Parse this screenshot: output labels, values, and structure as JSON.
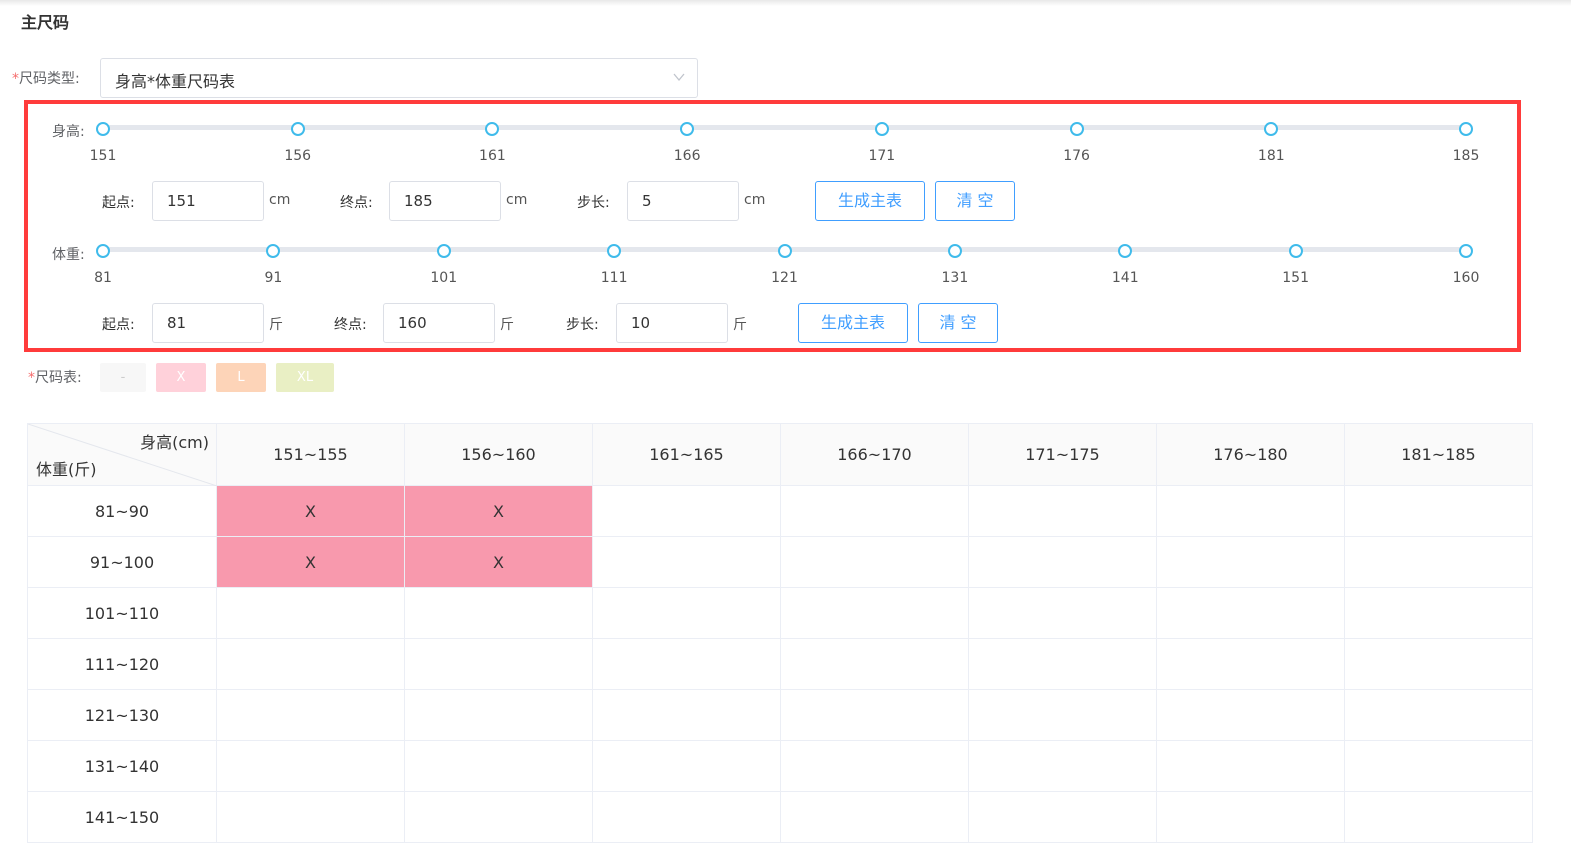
{
  "section_title": "主尺码",
  "size_type": {
    "required_mark": "*",
    "label": "尺码类型:",
    "value": "身高*体重尺码表"
  },
  "height": {
    "label": "身高:",
    "ticks": [
      "151",
      "156",
      "161",
      "166",
      "171",
      "176",
      "181",
      "185"
    ],
    "start_label": "起点:",
    "start_value": "151",
    "end_label": "终点:",
    "end_value": "185",
    "step_label": "步长:",
    "step_value": "5",
    "unit": "cm",
    "generate_button": "生成主表",
    "clear_button": "清 空"
  },
  "weight": {
    "label": "体重:",
    "ticks": [
      "81",
      "91",
      "101",
      "111",
      "121",
      "131",
      "141",
      "151",
      "160"
    ],
    "start_label": "起点:",
    "start_value": "81",
    "end_label": "终点:",
    "end_value": "160",
    "step_label": "步长:",
    "step_value": "10",
    "unit": "斤",
    "generate_button": "生成主表",
    "clear_button": "清 空"
  },
  "size_chart": {
    "required_mark": "*",
    "label": "尺码表:",
    "chips": [
      {
        "label": "-",
        "color": "#f7f7f7",
        "text_color": "#cccccc"
      },
      {
        "label": "X",
        "color": "#ffd1da",
        "text_color": "#ffffff"
      },
      {
        "label": "L",
        "color": "#fdd4b8",
        "text_color": "#ffffff"
      },
      {
        "label": "XL",
        "color": "#e9efc4",
        "text_color": "#ffffff"
      }
    ]
  },
  "table": {
    "corner_top": "身高(cm)",
    "corner_bottom": "体重(斤)",
    "columns": [
      "151~155",
      "156~160",
      "161~165",
      "166~170",
      "171~175",
      "176~180",
      "181~185"
    ],
    "rows": [
      {
        "label": "81~90",
        "cells": [
          "X",
          "X",
          "",
          "",
          "",
          "",
          ""
        ]
      },
      {
        "label": "91~100",
        "cells": [
          "X",
          "X",
          "",
          "",
          "",
          "",
          ""
        ]
      },
      {
        "label": "101~110",
        "cells": [
          "",
          "",
          "",
          "",
          "",
          "",
          ""
        ]
      },
      {
        "label": "111~120",
        "cells": [
          "",
          "",
          "",
          "",
          "",
          "",
          ""
        ]
      },
      {
        "label": "121~130",
        "cells": [
          "",
          "",
          "",
          "",
          "",
          "",
          ""
        ]
      },
      {
        "label": "131~140",
        "cells": [
          "",
          "",
          "",
          "",
          "",
          "",
          ""
        ]
      },
      {
        "label": "141~150",
        "cells": [
          "",
          "",
          "",
          "",
          "",
          "",
          ""
        ]
      }
    ],
    "filled_color": "#f899ad"
  },
  "colors": {
    "accent": "#409eff",
    "slider": "#3fbbeb",
    "highlight_box": "#ff3b3b"
  }
}
